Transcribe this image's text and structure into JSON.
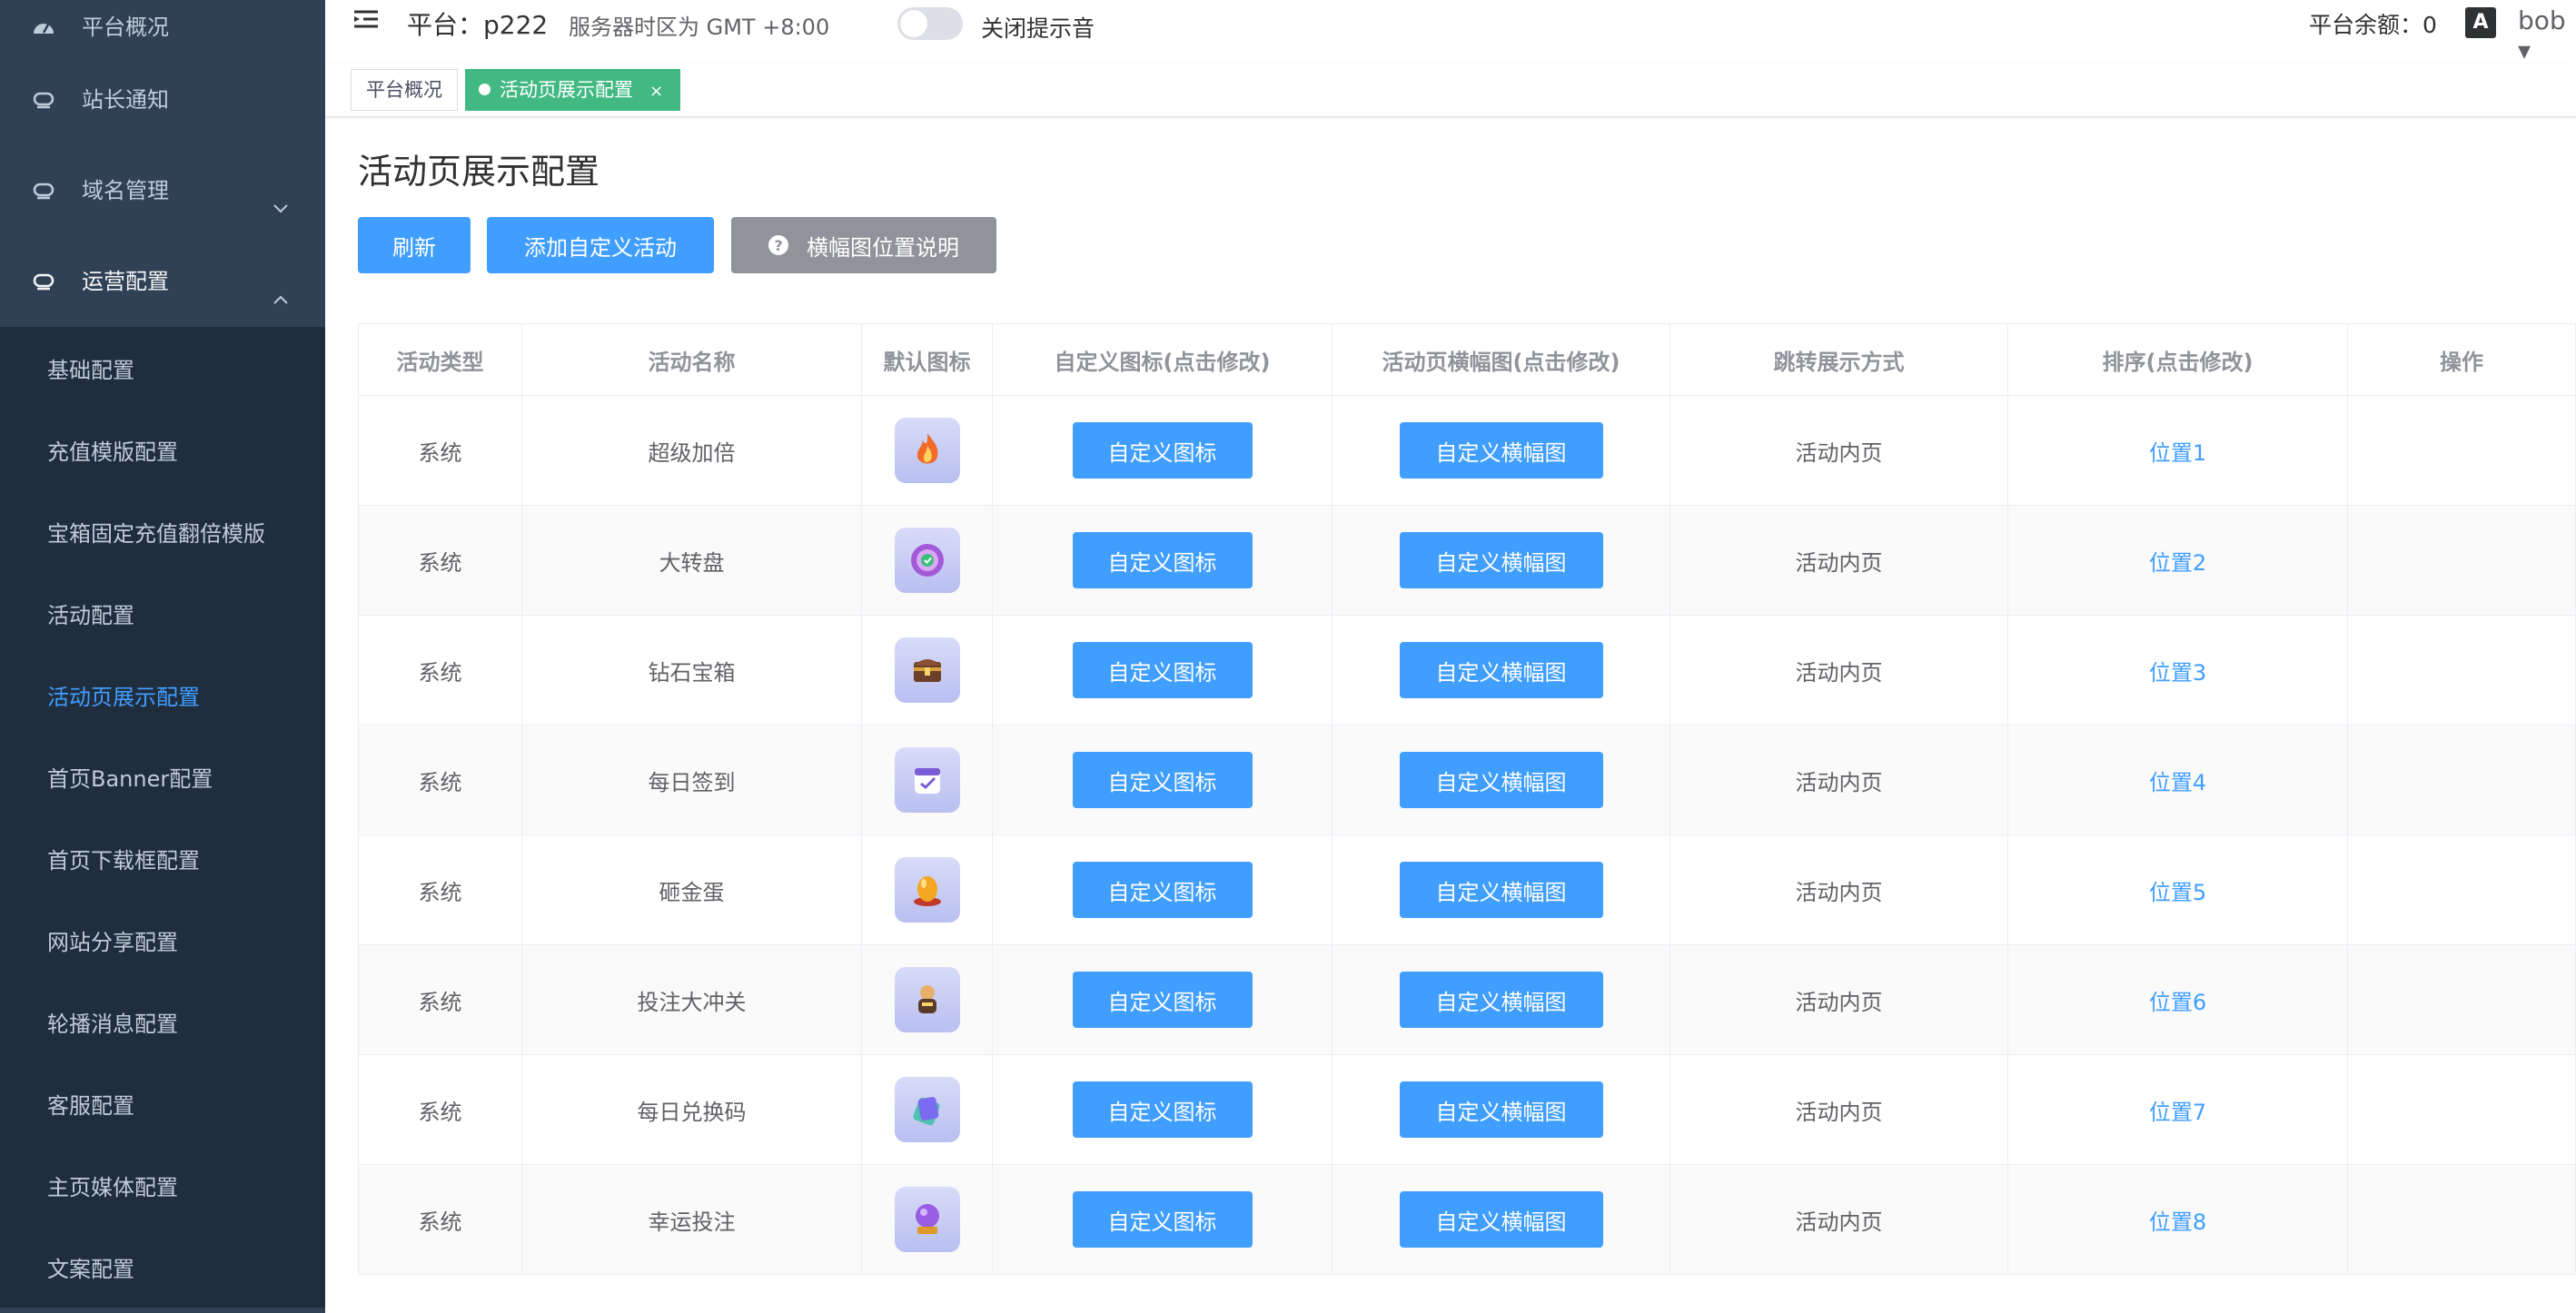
{
  "sidebar": {
    "top_items": [
      {
        "label": "平台概况",
        "icon": "dashboard-icon"
      },
      {
        "label": "站长通知",
        "icon": "bell-icon"
      },
      {
        "label": "域名管理",
        "icon": "domain-icon"
      },
      {
        "label": "运营配置",
        "icon": "settings-icon"
      }
    ],
    "sub_items": [
      {
        "label": "基础配置"
      },
      {
        "label": "充值模版配置"
      },
      {
        "label": "宝箱固定充值翻倍模版"
      },
      {
        "label": "活动配置"
      },
      {
        "label": "活动页展示配置"
      },
      {
        "label": "首页Banner配置"
      },
      {
        "label": "首页下载框配置"
      },
      {
        "label": "网站分享配置"
      },
      {
        "label": "轮播消息配置"
      },
      {
        "label": "客服配置"
      },
      {
        "label": "主页媒体配置"
      },
      {
        "label": "文案配置"
      }
    ],
    "active_sub_item": "活动页展示配置"
  },
  "header": {
    "platform": "平台：p222",
    "timezone": "服务器时区为 GMT +8:00",
    "mute_label": "关闭提示音",
    "mute_on": false,
    "balance": "平台余额：0",
    "lang_badge": "A",
    "user": "bob ▾"
  },
  "tags": [
    {
      "label": "平台概况"
    },
    {
      "label": "活动页展示配置",
      "close": "×"
    }
  ],
  "page": {
    "title": "活动页展示配置",
    "buttons": {
      "refresh": "刷新",
      "add": "添加自定义活动",
      "help": "横幅图位置说明",
      "help_icon": "?"
    }
  },
  "table": {
    "headers": [
      "活动类型",
      "活动名称",
      "默认图标",
      "自定义图标(点击修改)",
      "活动页横幅图(点击修改)",
      "跳转展示方式",
      "排序(点击修改)",
      "操作"
    ],
    "rows": [
      {
        "type": "系统",
        "name": "超级加倍",
        "icon": "fire-icon",
        "custom_icon_btn": "自定义图标",
        "banner_btn": "自定义横幅图",
        "jump": "活动内页",
        "order": "位置1"
      },
      {
        "type": "系统",
        "name": "大转盘",
        "icon": "wheel-icon",
        "custom_icon_btn": "自定义图标",
        "banner_btn": "自定义横幅图",
        "jump": "活动内页",
        "order": "位置2"
      },
      {
        "type": "系统",
        "name": "钻石宝箱",
        "icon": "chest-icon",
        "custom_icon_btn": "自定义图标",
        "banner_btn": "自定义横幅图",
        "jump": "活动内页",
        "order": "位置3"
      },
      {
        "type": "系统",
        "name": "每日签到",
        "icon": "calendar-icon",
        "custom_icon_btn": "自定义图标",
        "banner_btn": "自定义横幅图",
        "jump": "活动内页",
        "order": "位置4"
      },
      {
        "type": "系统",
        "name": "砸金蛋",
        "icon": "golden-egg-icon",
        "custom_icon_btn": "自定义图标",
        "banner_btn": "自定义横幅图",
        "jump": "活动内页",
        "order": "位置5"
      },
      {
        "type": "系统",
        "name": "投注大冲关",
        "icon": "character-icon",
        "custom_icon_btn": "自定义图标",
        "banner_btn": "自定义横幅图",
        "jump": "活动内页",
        "order": "位置6"
      },
      {
        "type": "系统",
        "name": "每日兑换码",
        "icon": "ticket-icon",
        "custom_icon_btn": "自定义图标",
        "banner_btn": "自定义横幅图",
        "jump": "活动内页",
        "order": "位置7"
      },
      {
        "type": "系统",
        "name": "幸运投注",
        "icon": "crystal-ball-icon",
        "custom_icon_btn": "自定义图标",
        "banner_btn": "自定义横幅图",
        "jump": "活动内页",
        "order": "位置8"
      }
    ]
  },
  "colors": {
    "sidebar_bg": "#304156",
    "submenu_bg": "#1f2d3d",
    "primary": "#409eff",
    "tag_active": "#42b983",
    "info_btn": "#909399"
  }
}
